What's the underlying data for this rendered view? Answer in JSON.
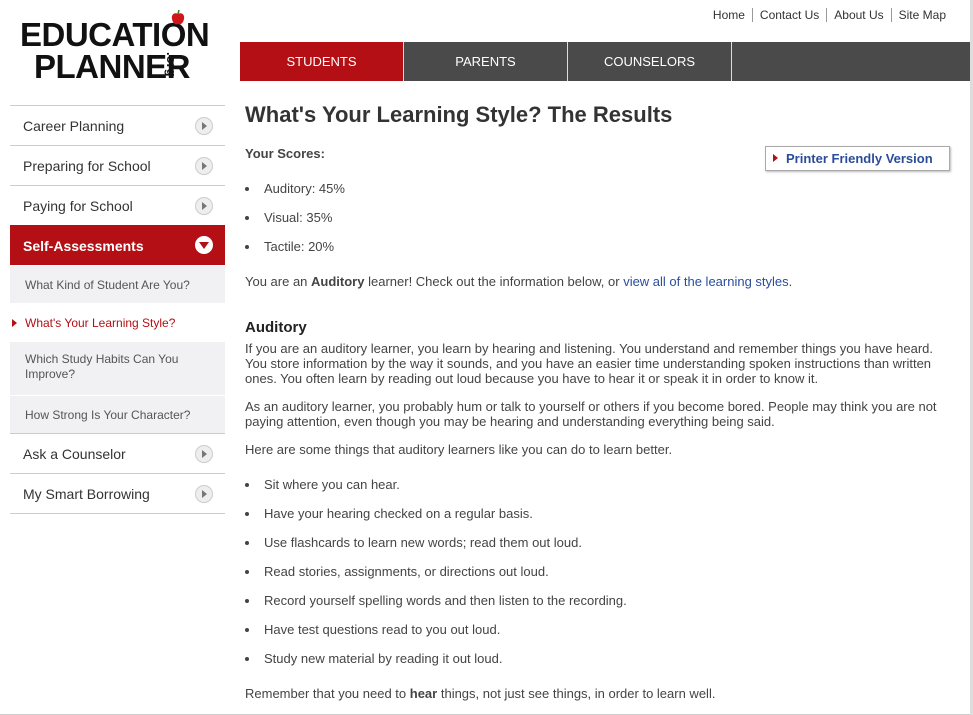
{
  "logo": {
    "line1": "EDUCATION",
    "line2": "PLANNER",
    "org": ".org"
  },
  "top_links": [
    "Home",
    "Contact Us",
    "About Us",
    "Site Map"
  ],
  "tabs": [
    {
      "label": "STUDENTS",
      "active": true
    },
    {
      "label": "PARENTS",
      "active": false
    },
    {
      "label": "COUNSELORS",
      "active": false
    }
  ],
  "sidebar": {
    "items": [
      {
        "label": "Career Planning"
      },
      {
        "label": "Preparing for School"
      },
      {
        "label": "Paying for School"
      },
      {
        "label": "Self-Assessments"
      },
      {
        "label": "Ask a Counselor"
      },
      {
        "label": "My Smart Borrowing"
      }
    ],
    "subitems": [
      {
        "label": "What Kind of Student Are You?"
      },
      {
        "label": "What's Your Learning Style?"
      },
      {
        "label": "Which Study Habits Can You Improve?"
      },
      {
        "label": "How Strong Is Your Character?"
      }
    ]
  },
  "main": {
    "title": "What's Your Learning Style? The Results",
    "scores_title": "Your Scores:",
    "printer_label": "Printer Friendly Version",
    "scores": [
      "Auditory: 45%",
      "Visual: 35%",
      "Tactile: 20%"
    ],
    "result_pre": "You are an ",
    "result_bold": "Auditory",
    "result_mid": " learner! Check out the information below, or ",
    "result_link": "view all of the learning styles",
    "result_end": ".",
    "section_title": "Auditory",
    "para1": "If you are an auditory learner, you learn by hearing and listening. You understand and remember things you have heard. You store information by the way it sounds, and you have an easier time understanding spoken instructions than written ones. You often learn by reading out loud because you have to hear it or speak it in order to know it.",
    "para2": "As an auditory learner, you probably hum or talk to yourself or others if you become bored. People may think you are not paying attention, even though you may be hearing and understanding everything being said.",
    "para3": "Here are some things that auditory learners like you can do to learn better.",
    "tips": [
      "Sit where you can hear.",
      "Have your hearing checked on a regular basis.",
      "Use flashcards to learn new words; read them out loud.",
      "Read stories, assignments, or directions out loud.",
      "Record yourself spelling words and then listen to the recording.",
      "Have test questions read to you out loud.",
      "Study new material by reading it out loud."
    ],
    "closing_pre": "Remember that you need to ",
    "closing_bold": "hear",
    "closing_end": " things, not just see things, in order to learn well."
  },
  "colors": {
    "brand_red": "#b30f14",
    "nav_gray": "#4a4a4a",
    "link_blue": "#2a4d9b"
  }
}
